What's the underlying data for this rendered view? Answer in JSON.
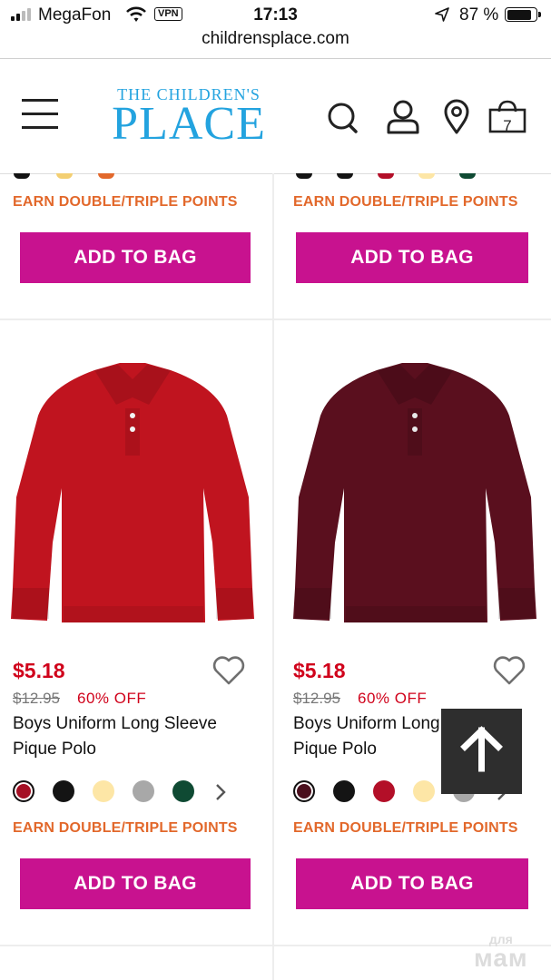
{
  "status_bar": {
    "carrier": "MegaFon",
    "vpn": "VPN",
    "time": "17:13",
    "battery": "87 %"
  },
  "browser": {
    "url": "childrensplace.com"
  },
  "header": {
    "logo_line1": "THE CHILDREN'S",
    "logo_line2": "PLACE",
    "cart_count": "7"
  },
  "top_row": {
    "left": {
      "points": "EARN DOUBLE/TRIPLE POINTS",
      "button": "ADD TO BAG"
    },
    "right": {
      "points": "EARN DOUBLE/TRIPLE POINTS",
      "button": "ADD TO BAG"
    }
  },
  "products": [
    {
      "price": "$5.18",
      "was_price": "$12.95",
      "discount": "60% OFF",
      "name": "Boys Uniform Long Sleeve Pique Polo",
      "shirt_color": "#c0141f",
      "swatches": [
        "#a50f24",
        "#141414",
        "#fde6a6",
        "#a8a8a8",
        "#0f4a33"
      ],
      "points": "EARN DOUBLE/TRIPLE POINTS",
      "button": "ADD TO BAG"
    },
    {
      "price": "$5.18",
      "was_price": "$12.95",
      "discount": "60% OFF",
      "name": "Boys Uniform Long Sleeve Pique Polo",
      "shirt_color": "#5a0f1e",
      "swatches": [
        "#4a0f1d",
        "#141414",
        "#b30f28",
        "#fde6a6",
        "#a8a8a8"
      ],
      "points": "EARN DOUBLE/TRIPLE POINTS",
      "button": "ADD TO BAG"
    }
  ],
  "watermark": {
    "line1": "для",
    "line2": "мам"
  }
}
